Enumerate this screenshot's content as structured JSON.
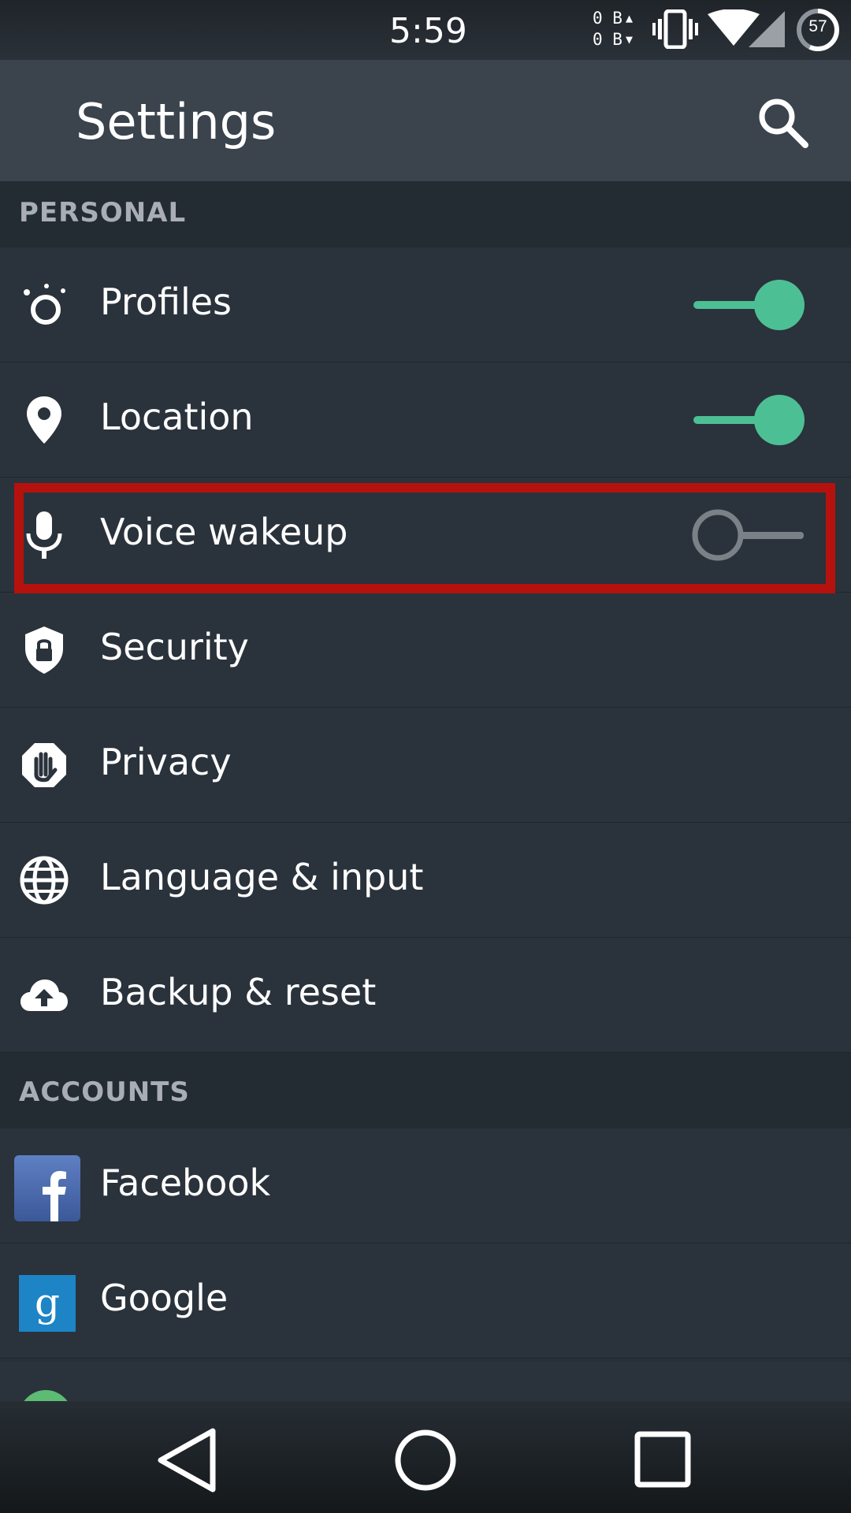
{
  "status_bar": {
    "time": "5:59",
    "net_up": "0 B",
    "net_down": "0 B",
    "battery_level": "57",
    "icons": [
      "vibrate-icon",
      "wifi-icon",
      "cell-signal-icon",
      "battery-icon"
    ]
  },
  "toolbar": {
    "title": "Settings",
    "search_icon": "search-icon"
  },
  "sections": {
    "personal": "PERSONAL",
    "accounts": "ACCOUNTS"
  },
  "personal_items": [
    {
      "label": "Profiles",
      "icon": "profiles-icon",
      "toggle": true
    },
    {
      "label": "Location",
      "icon": "location-pin-icon",
      "toggle": true
    },
    {
      "label": "Voice wakeup",
      "icon": "microphone-icon",
      "toggle": false
    },
    {
      "label": "Security",
      "icon": "shield-lock-icon"
    },
    {
      "label": "Privacy",
      "icon": "privacy-hand-icon"
    },
    {
      "label": "Language & input",
      "icon": "globe-icon"
    },
    {
      "label": "Backup & reset",
      "icon": "cloud-upload-icon"
    }
  ],
  "account_items": [
    {
      "label": "Facebook",
      "icon": "facebook-icon"
    },
    {
      "label": "Google",
      "icon": "google-icon"
    }
  ],
  "nav_bar": {
    "buttons": [
      "back-icon",
      "home-icon",
      "recents-icon"
    ]
  },
  "colors": {
    "toggle_on": "#4dbf94",
    "toggle_off": "#7b8287",
    "highlight": "#b5120e"
  }
}
